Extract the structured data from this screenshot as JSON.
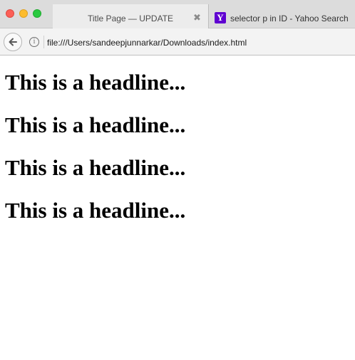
{
  "browser": {
    "tabs": [
      {
        "title": "Title Page — UPDATE",
        "close_glyph": "✖",
        "active": true
      },
      {
        "title": "selector p in ID - Yahoo Search",
        "favicon_letter": "Y",
        "favicon_color": "#5f01d1",
        "active": false
      }
    ],
    "address_bar": {
      "url": "file:///Users/sandeepjunnarkar/Downloads/index.html",
      "info_glyph": "i"
    }
  },
  "page": {
    "headlines": [
      "This is a headline...",
      "This is a headline...",
      "This is a headline...",
      "This is a headline..."
    ]
  }
}
